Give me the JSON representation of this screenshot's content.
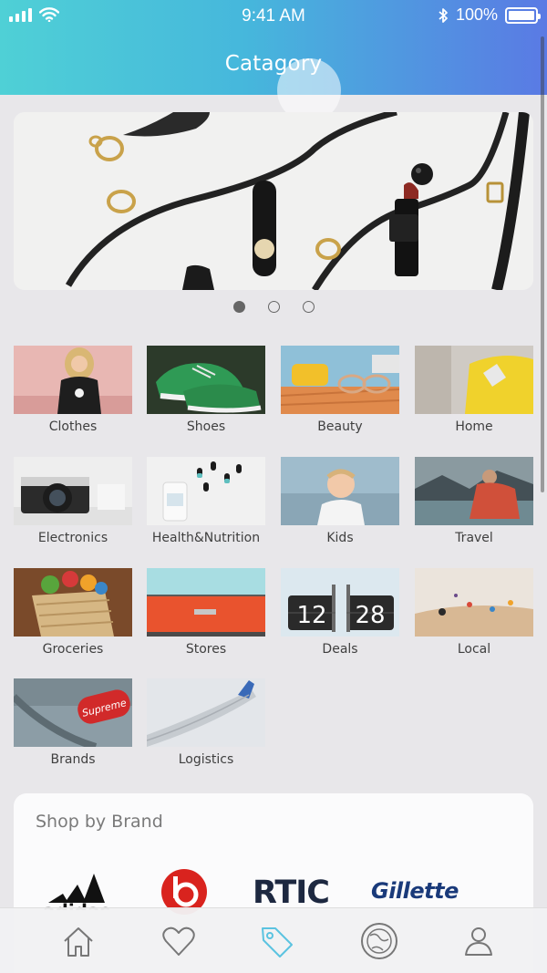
{
  "status_bar": {
    "time": "9:41 AM",
    "battery": "100%",
    "battery_level": 1.0
  },
  "header": {
    "title": "Catagory"
  },
  "carousel": {
    "page_count": 3,
    "active_index": 0
  },
  "categories": [
    {
      "label": "Clothes"
    },
    {
      "label": "Shoes"
    },
    {
      "label": "Beauty"
    },
    {
      "label": "Home"
    },
    {
      "label": "Electronics"
    },
    {
      "label": "Health&Nutrition"
    },
    {
      "label": "Kids"
    },
    {
      "label": "Travel"
    },
    {
      "label": "Groceries"
    },
    {
      "label": "Stores"
    },
    {
      "label": "Deals"
    },
    {
      "label": "Local"
    },
    {
      "label": "Brands"
    },
    {
      "label": "Logistics"
    }
  ],
  "deals_image_text": {
    "left": "12",
    "right": "28"
  },
  "brands_image_text": "Supreme",
  "shop_by_brand": {
    "title": "Shop by Brand",
    "brands": [
      "adidas",
      "beats",
      "RTIC",
      "Gillette"
    ]
  },
  "tabbar": {
    "tabs": [
      "home-icon",
      "heart-icon",
      "tag-icon",
      "globe-icon",
      "user-icon"
    ],
    "active_index": 2
  },
  "colors": {
    "header_start": "#4fd0d6",
    "header_end": "#5a7ae4",
    "active_tab": "#5bc3e0",
    "background": "#e8e7ea"
  }
}
